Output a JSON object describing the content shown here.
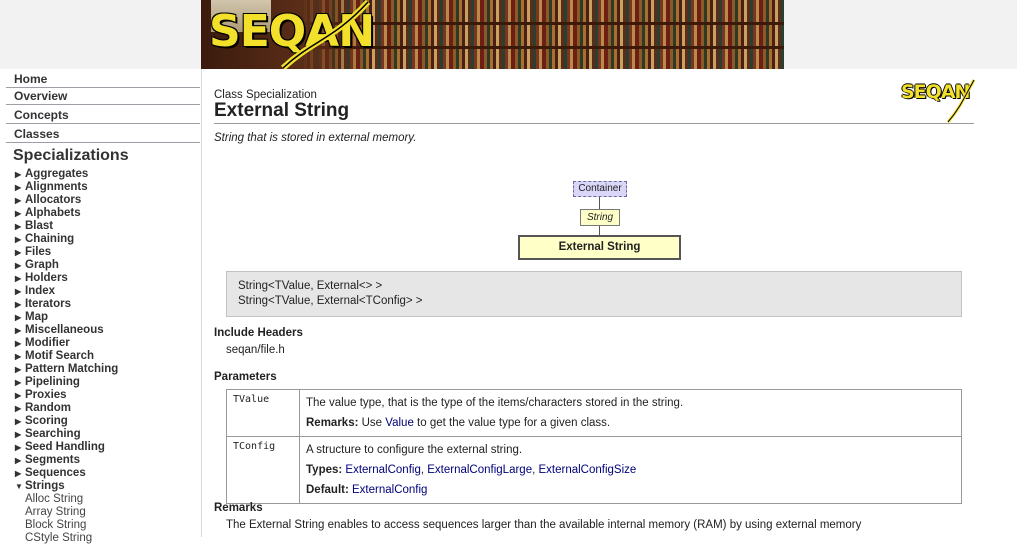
{
  "banner": {
    "logo_text": "SEQAN"
  },
  "sidebar": {
    "nav": [
      "Home",
      "Overview",
      "Concepts",
      "Classes"
    ],
    "section_title": "Specializations",
    "items": [
      "Aggregates",
      "Alignments",
      "Allocators",
      "Alphabets",
      "Blast",
      "Chaining",
      "Files",
      "Graph",
      "Holders",
      "Index",
      "Iterators",
      "Map",
      "Miscellaneous",
      "Modifier",
      "Motif Search",
      "Pattern Matching",
      "Pipelining",
      "Proxies",
      "Random",
      "Scoring",
      "Searching",
      "Seed Handling",
      "Segments",
      "Sequences",
      "Strings"
    ],
    "expanded_item": "Strings",
    "sub_items": [
      "Alloc String",
      "Array String",
      "Block String",
      "CStyle String"
    ]
  },
  "main": {
    "kind": "Class Specialization",
    "title": "External String",
    "logo_text": "SEQAN",
    "summary": "String that is stored in external memory.",
    "diagram": {
      "parent": "Container",
      "middle": "String",
      "current": "External String"
    },
    "signatures": [
      "String<TValue, External<> >",
      "String<TValue, External<TConfig> >"
    ],
    "include_heading": "Include Headers",
    "include_value": "seqan/file.h",
    "parameters_heading": "Parameters",
    "parameters": [
      {
        "name": "TValue",
        "description": "The value type, that is the type of the items/characters stored in the string.",
        "remarks_label": "Remarks:",
        "remarks_pre": "Use",
        "remarks_link": "Value",
        "remarks_post": "to get the value type for a given class."
      },
      {
        "name": "TConfig",
        "description": "A structure to configure the external string.",
        "types_label": "Types:",
        "types": [
          "ExternalConfig",
          "ExternalConfigLarge",
          "ExternalConfigSize"
        ],
        "default_label": "Default:",
        "default": "ExternalConfig"
      }
    ],
    "remarks_heading": "Remarks",
    "remarks_text": "The External String enables to access sequences larger than the available internal memory (RAM) by using external memory"
  },
  "colors": {
    "link": "#00007a",
    "logo_yellow": "#f2e02a",
    "diagram_parent": "#d9d6f7",
    "diagram_node": "#ffffc8",
    "signature_bg": "#e6e6e6"
  }
}
